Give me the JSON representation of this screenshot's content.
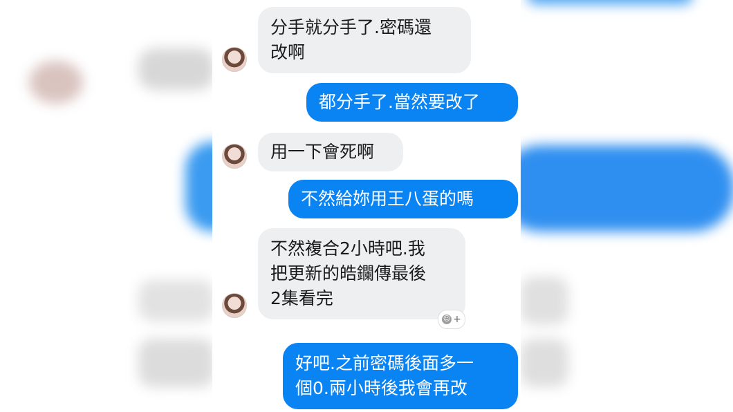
{
  "messages": [
    {
      "side": "in",
      "text": "分手就分手了.密碼還\n改啊"
    },
    {
      "side": "out",
      "text": "都分手了.當然要改了"
    },
    {
      "side": "in",
      "text": "用一下會死啊"
    },
    {
      "side": "out",
      "text": "不然給妳用王八蛋的嗎"
    },
    {
      "side": "in",
      "text": "不然複合2小時吧.我\n把更新的皓鑭傳最後\n2集看完"
    },
    {
      "side": "out",
      "text": "好吧.之前密碼後面多一\n個0.兩小時後我會再改"
    }
  ],
  "reaction": {
    "icon": "add-reaction-icon",
    "plus": "+"
  },
  "colors": {
    "incoming_bubble": "#eeeff1",
    "outgoing_bubble": "#0a84f3"
  }
}
